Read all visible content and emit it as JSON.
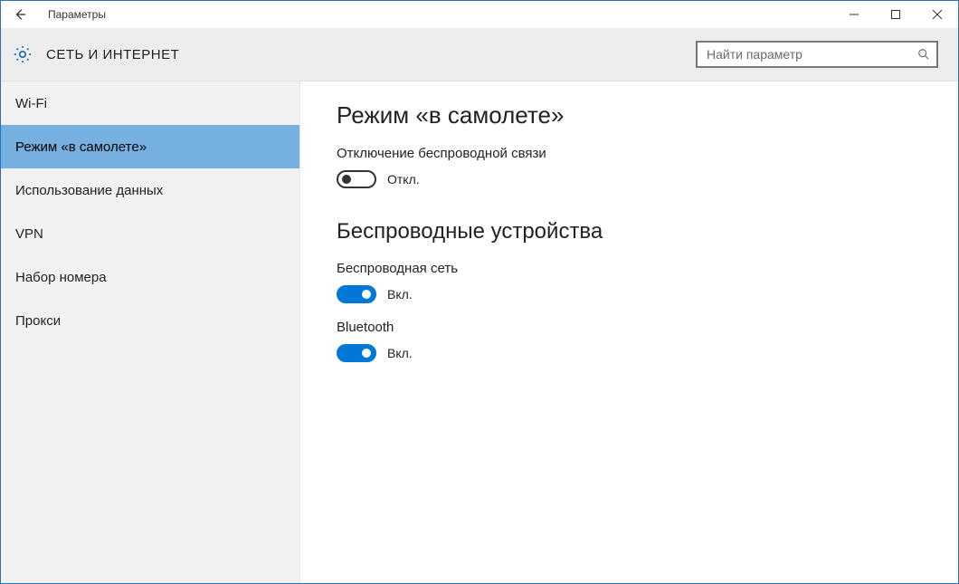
{
  "window": {
    "title": "Параметры"
  },
  "header": {
    "category": "СЕТЬ И ИНТЕРНЕТ",
    "search_placeholder": "Найти параметр"
  },
  "sidebar": {
    "items": [
      {
        "label": "Wi-Fi",
        "selected": false
      },
      {
        "label": "Режим «в самолете»",
        "selected": true
      },
      {
        "label": "Использование данных",
        "selected": false
      },
      {
        "label": "VPN",
        "selected": false
      },
      {
        "label": "Набор номера",
        "selected": false
      },
      {
        "label": "Прокси",
        "selected": false
      }
    ]
  },
  "main": {
    "heading1": "Режим «в самолете»",
    "airplane": {
      "description": "Отключение беспроводной связи",
      "state": "off",
      "state_label": "Откл."
    },
    "heading2": "Беспроводные устройства",
    "wireless": {
      "label": "Беспроводная сеть",
      "state": "on",
      "state_label": "Вкл."
    },
    "bluetooth": {
      "label": "Bluetooth",
      "state": "on",
      "state_label": "Вкл."
    }
  }
}
